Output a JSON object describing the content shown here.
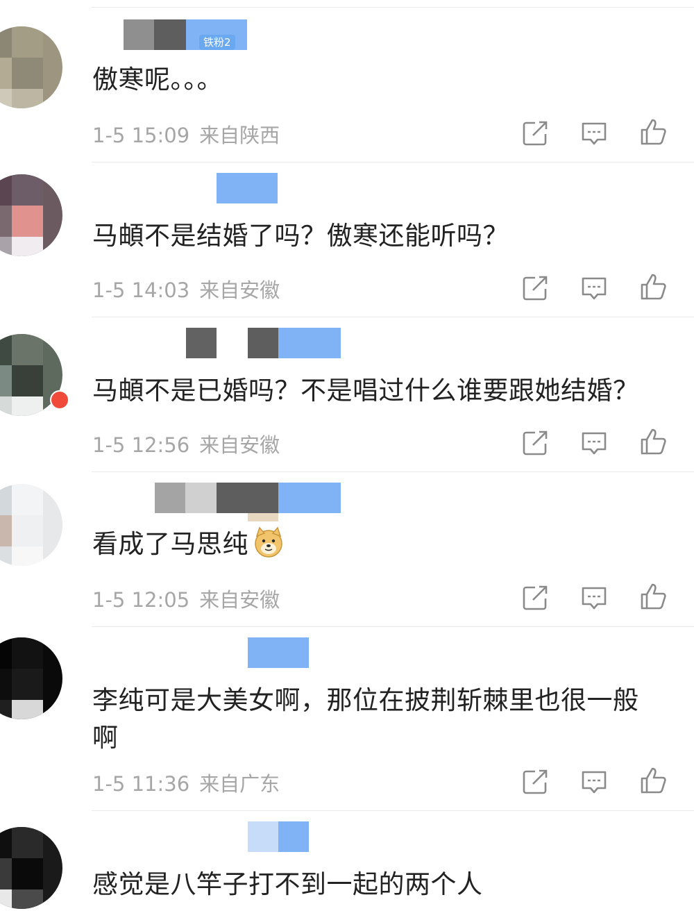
{
  "comments": [
    {
      "username_visible": "",
      "badge": "铁粉2",
      "text": "傲寒呢。。。",
      "time": "1-5 15:09",
      "location": "来自陕西"
    },
    {
      "username_visible": "",
      "badge": "",
      "text": "马頔不是结婚了吗？傲寒还能听吗？",
      "time": "1-5 14:03",
      "location": "来自安徽"
    },
    {
      "username_visible": "",
      "badge": "",
      "text": "马頔不是已婚吗？不是唱过什么谁要跟她结婚？",
      "time": "1-5 12:56",
      "location": "来自安徽"
    },
    {
      "username_visible": "",
      "badge": "",
      "text": "看成了马思纯",
      "emoji": "doge-emoji",
      "time": "1-5 12:05",
      "location": "来自安徽"
    },
    {
      "username_visible": "",
      "badge": "",
      "text": "李纯可是大美女啊，那位在披荆斩棘里也很一般啊",
      "time": "1-5 11:36",
      "location": "来自广东"
    },
    {
      "username_visible": "",
      "badge": "",
      "text": "感觉是八竿子打不到一起的两个人",
      "time": "",
      "location": ""
    }
  ],
  "icons": {
    "share": "share-icon",
    "reply": "comment-icon",
    "like": "thumbs-up-icon"
  },
  "colors": {
    "text": "#222222",
    "meta": "#a6a6a6",
    "divider": "#e9e9e9",
    "icon": "#8a8a8a",
    "badge": "#6aa8f0"
  }
}
